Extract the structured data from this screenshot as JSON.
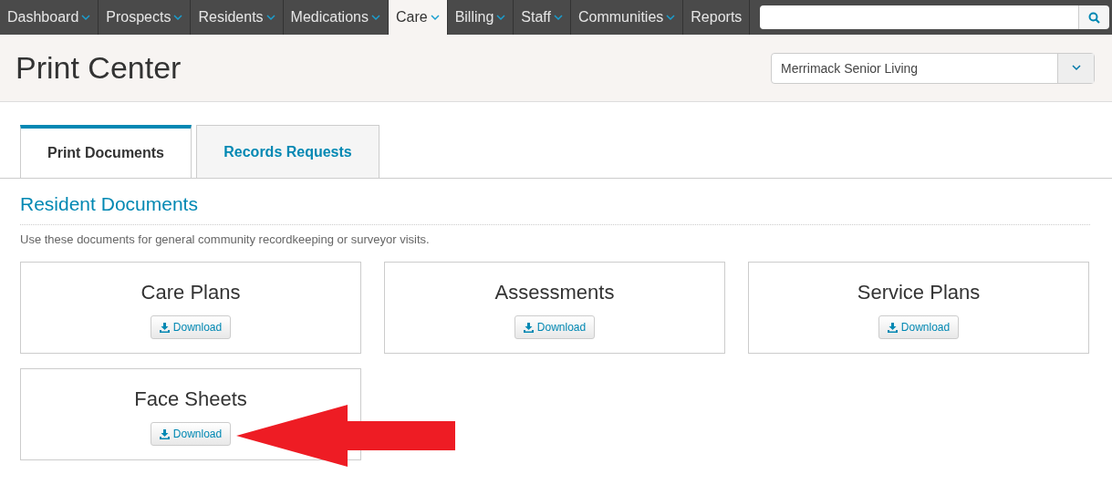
{
  "nav": {
    "items": [
      {
        "label": "Dashboard",
        "dropdown": true,
        "selected": false
      },
      {
        "label": "Prospects",
        "dropdown": true,
        "selected": false
      },
      {
        "label": "Residents",
        "dropdown": true,
        "selected": false
      },
      {
        "label": "Medications",
        "dropdown": true,
        "selected": false
      },
      {
        "label": "Care",
        "dropdown": true,
        "selected": true
      },
      {
        "label": "Billing",
        "dropdown": true,
        "selected": false
      },
      {
        "label": "Staff",
        "dropdown": true,
        "selected": false
      },
      {
        "label": "Communities",
        "dropdown": true,
        "selected": false
      },
      {
        "label": "Reports",
        "dropdown": false,
        "selected": false
      }
    ]
  },
  "page": {
    "title": "Print Center",
    "community_select": {
      "value": "Merrimack Senior Living"
    }
  },
  "tabs": [
    {
      "label": "Print Documents",
      "selected": true
    },
    {
      "label": "Records Requests",
      "selected": false
    }
  ],
  "section": {
    "title": "Resident Documents",
    "description": "Use these documents for general community recordkeeping or surveyor visits.",
    "cards": [
      {
        "title": "Care Plans",
        "button": "Download",
        "highlighted": false
      },
      {
        "title": "Assessments",
        "button": "Download",
        "highlighted": false
      },
      {
        "title": "Service Plans",
        "button": "Download",
        "highlighted": false
      },
      {
        "title": "Face Sheets",
        "button": "Download",
        "highlighted": true
      }
    ]
  }
}
